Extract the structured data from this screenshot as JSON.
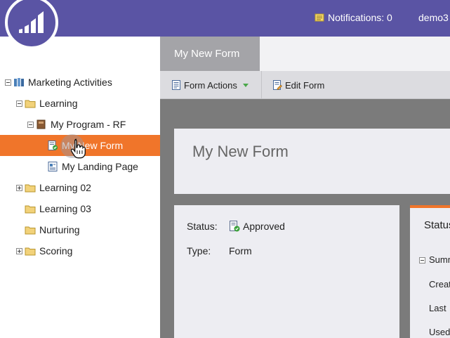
{
  "header": {
    "notifications_label": "Notifications: 0",
    "user_label": "demo3",
    "bg_color": "#5a54a4"
  },
  "tree": {
    "items": [
      {
        "label": "Marketing Activities",
        "icon": "marketing-activities-icon",
        "toggle": "minus"
      },
      {
        "label": "Learning",
        "icon": "folder-icon",
        "toggle": "minus"
      },
      {
        "label": "My Program - RF",
        "icon": "program-icon",
        "toggle": "minus"
      },
      {
        "label": "My New Form",
        "icon": "form-approved-icon",
        "toggle": "none",
        "selected": true
      },
      {
        "label": "My Landing Page",
        "icon": "landing-page-icon",
        "toggle": "none"
      },
      {
        "label": "Learning 02",
        "icon": "folder-icon",
        "toggle": "plus"
      },
      {
        "label": "Learning 03",
        "icon": "folder-icon",
        "toggle": "none"
      },
      {
        "label": "Nurturing",
        "icon": "folder-icon",
        "toggle": "none"
      },
      {
        "label": "Scoring",
        "icon": "folder-icon",
        "toggle": "plus"
      }
    ],
    "selected_color": "#f0752a"
  },
  "main": {
    "tab_label": "My New Form",
    "toolbar": {
      "form_actions_label": "Form Actions",
      "edit_form_label": "Edit Form"
    },
    "title": "My New Form",
    "details": {
      "status_label": "Status:",
      "status_value": "Approved",
      "type_label": "Type:",
      "type_value": "Form"
    },
    "status_panel": {
      "title": "Status",
      "summary_label": "Summary",
      "created_label": "Created",
      "last_label": "Last",
      "used_label": "Used"
    }
  }
}
